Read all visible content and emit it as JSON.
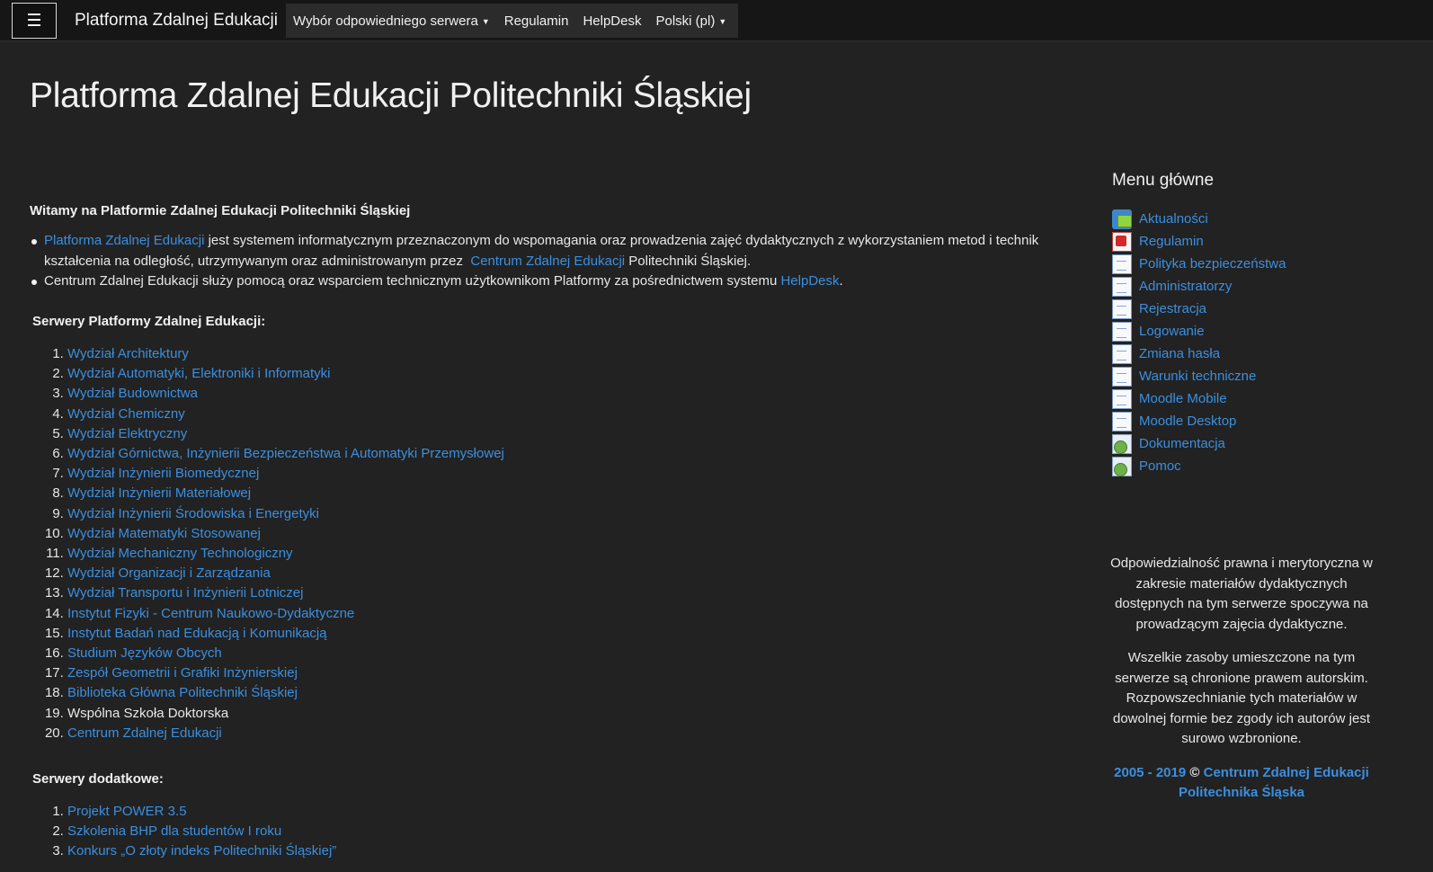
{
  "navbar": {
    "menu_icon": "hamburger-icon",
    "brand": "Platforma Zdalnej Edukacji",
    "items": [
      {
        "label": "Wybór odpowiedniego serwera",
        "dropdown": true
      },
      {
        "label": "Regulamin",
        "dropdown": false
      },
      {
        "label": "HelpDesk",
        "dropdown": false
      },
      {
        "label": "Polski (pl)",
        "dropdown": true
      }
    ]
  },
  "page_title": "Platforma Zdalnej Edukacji Politechniki Śląskiej",
  "main": {
    "welcome": "Witamy na Platformie Zdalnej Edukacji Politechniki Śląskiej",
    "bullet1": {
      "link1": "Platforma Zdalnej Edukacji",
      "text1": "jest systemem informatycznym przeznaczonym do wspomagania oraz prowadzenia zajęć dydaktycznych z wykorzystaniem metod i technik kształcenia na odległość, utrzymywanym oraz administrowanym przez",
      "link2": "Centrum Zdalnej Edukacji",
      "text2": "Politechniki Śląskiej."
    },
    "bullet2": {
      "text1": "Centrum Zdalnej Edukacji służy pomocą oraz wsparciem technicznym użytkownikom Platformy za pośrednictwem systemu",
      "link": "HelpDesk",
      "text2": "."
    },
    "servers_title": "Serwery Platformy Zdalnej Edukacji:",
    "servers": [
      {
        "label": "Wydział Architektury",
        "link": true
      },
      {
        "label": "Wydział Automatyki, Elektroniki i Informatyki",
        "link": true
      },
      {
        "label": "Wydział Budownictwa",
        "link": true
      },
      {
        "label": "Wydział Chemiczny",
        "link": true
      },
      {
        "label": "Wydział Elektryczny",
        "link": true
      },
      {
        "label": "Wydział Górnictwa, Inżynierii Bezpieczeństwa i Automatyki Przemysłowej",
        "link": true
      },
      {
        "label": "Wydział Inżynierii Biomedycznej",
        "link": true
      },
      {
        "label": "Wydział Inżynierii Materiałowej",
        "link": true
      },
      {
        "label": "Wydział Inżynierii Środowiska i Energetyki",
        "link": true
      },
      {
        "label": "Wydział Matematyki Stosowanej",
        "link": true
      },
      {
        "label": "Wydział Mechaniczny Technologiczny",
        "link": true
      },
      {
        "label": "Wydział Organizacji i Zarządzania",
        "link": true
      },
      {
        "label": "Wydział Transportu i Inżynierii Lotniczej",
        "link": true
      },
      {
        "label": "Instytut Fizyki - Centrum Naukowo-Dydaktyczne",
        "link": true
      },
      {
        "label": "Instytut Badań nad Edukacją i Komunikacją",
        "link": true
      },
      {
        "label": "Studium Języków Obcych",
        "link": true
      },
      {
        "label": "Zespół Geometrii i Grafiki Inżynierskiej",
        "link": true
      },
      {
        "label": "Biblioteka Główna Politechniki Śląskiej",
        "link": true
      },
      {
        "label": "Wspólna Szkoła Doktorska",
        "link": false
      },
      {
        "label": "Centrum Zdalnej Edukacji",
        "link": true
      }
    ],
    "extra_title": "Serwery dodatkowe:",
    "extra_servers": [
      {
        "label": "Projekt POWER 3.5",
        "link": true
      },
      {
        "label": "Szkolenia BHP dla studentów I roku",
        "link": true
      },
      {
        "label": "Konkurs „O złoty indeks Politechniki Śląskiej”",
        "link": true
      }
    ]
  },
  "sidebar": {
    "title": "Menu główne",
    "items": [
      {
        "label": "Aktualności",
        "icon": "forum-icon"
      },
      {
        "label": "Regulamin",
        "icon": "pdf-icon"
      },
      {
        "label": "Polityka bezpieczeństwa",
        "icon": "page-icon"
      },
      {
        "label": "Administratorzy",
        "icon": "page-icon"
      },
      {
        "label": "Rejestracja",
        "icon": "page-icon"
      },
      {
        "label": "Logowanie",
        "icon": "page-icon"
      },
      {
        "label": "Zmiana hasła",
        "icon": "page-icon"
      },
      {
        "label": "Warunki techniczne",
        "icon": "page-icon"
      },
      {
        "label": "Moodle Mobile",
        "icon": "page-icon"
      },
      {
        "label": "Moodle Desktop",
        "icon": "page-icon"
      },
      {
        "label": "Dokumentacja",
        "icon": "url-globe-icon"
      },
      {
        "label": "Pomoc",
        "icon": "url-globe-icon"
      }
    ],
    "disclaimer1": "Odpowiedzialność prawna i merytoryczna w zakresie materiałów dydaktycznych dostępnych na tym serwerze spoczywa na prowadzącym zajęcia dydaktyczne.",
    "disclaimer2": "Wszelkie zasoby umieszczone na tym serwerze są chronione prawem autorskim. Rozpowszechnianie tych materiałów w dowolnej formie bez zgody ich autorów jest surowo wzbronione.",
    "copyright_years": "2005 - 2019",
    "copyright_symbol": "©",
    "copyright_org": "Centrum Zdalnej Edukacji",
    "copyright_org2": "Politechnika Śląska"
  },
  "colors": {
    "background": "#222222",
    "navbar": "#161616",
    "link": "#3b8fe0",
    "text": "#e8e8e8"
  }
}
